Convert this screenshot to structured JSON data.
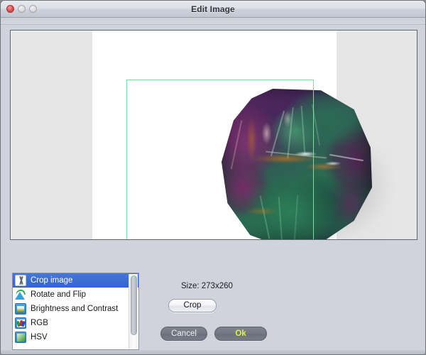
{
  "window": {
    "title": "Edit Image",
    "controls": [
      {
        "name": "close",
        "icon": "close-traffic-light"
      },
      {
        "name": "minimize",
        "icon": "minimize-traffic-light"
      },
      {
        "name": "zoom",
        "icon": "zoom-traffic-light"
      }
    ]
  },
  "preview": {
    "panel_background": "#e6e6e6",
    "canvas_background": "#ffffff",
    "crop_rect_color": "#7fde9e",
    "image_description": "fluorite crystal specimen with purple and green zoned facets on white background"
  },
  "tools": {
    "selected_index": 0,
    "items": [
      {
        "label": "Crop image",
        "icon": "scissors-icon"
      },
      {
        "label": "Rotate and Flip",
        "icon": "rotate-arrow-icon"
      },
      {
        "label": "Brightness and Contrast",
        "icon": "brightness-bar-icon"
      },
      {
        "label": "RGB",
        "icon": "rgb-arrows-icon"
      },
      {
        "label": "HSV",
        "icon": "hsv-gradient-icon"
      }
    ]
  },
  "options": {
    "size_label": "Size: 273x260",
    "crop_button_label": "Crop"
  },
  "footer": {
    "cancel_label": "Cancel",
    "ok_label": "Ok",
    "cancel_color": "#eceff4",
    "ok_color": "#dff443"
  }
}
